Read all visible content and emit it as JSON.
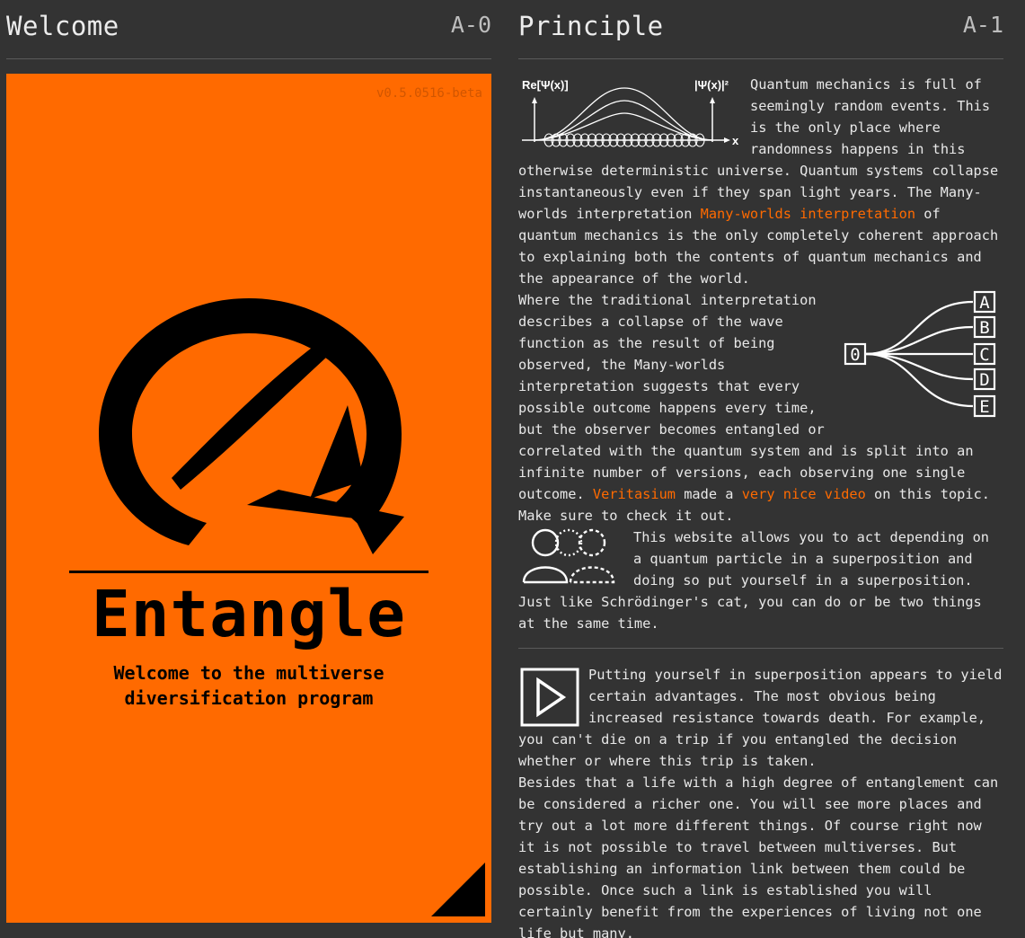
{
  "left_panel": {
    "title": "Welcome",
    "code": "A-0",
    "card": {
      "version": "v0.5.0516-beta",
      "brand": "Entangle",
      "tagline_line1": "Welcome to the multiverse",
      "tagline_line2": "diversification program",
      "accent_color": "#ff6a00"
    }
  },
  "right_panel": {
    "title": "Principle",
    "code": "A-1",
    "wave_figure": {
      "label_left": "Re[Ψ(x)]",
      "label_right": "|Ψ(x)|²",
      "axis_label": "x"
    },
    "branch_figure": {
      "source": "0",
      "outcomes": [
        "A",
        "B",
        "C",
        "D",
        "E"
      ]
    },
    "section1": {
      "p1": "Quantum mechanics is full of seemingly random events. This is the only place where randomness happens in this otherwise deterministic universe. Quantum systems collapse instantaneously even if they span light years. The Many-worlds interpretation ",
      "link_many_worlds": "Many-worlds interpretation",
      "p1_end": " of quantum mechanics is the only completely coherent approach to explaining both the contents of quantum mechanics and the appearance of the world.",
      "p2": "Where the traditional interpretation describes a collapse of the wave function as the result of being observed, the Many-worlds interpretation suggests that every possible outcome happens every time, but the observer becomes entangled or correlated with the quantum system and is split into an infinite number of versions, each observing one single outcome. ",
      "link_veritasium": "Veritasium",
      "p2_mid": " made a ",
      "link_video": "very nice video",
      "p2_end": " on this topic. Make sure to check it out.",
      "p3": "This website allows you to act depending on a quantum particle in a superposition and doing so put yourself in a superposition. Just like Schrödinger's cat, you can do or be two things at the same time."
    },
    "section2": {
      "p1": "Putting yourself in superposition appears to yield certain advantages. The most obvious being increased resistance towards death. For example, you can't die on a trip if you entangled the decision whether or where this trip is taken.",
      "p2": "Besides that a life with a high degree of entanglement can be considered a richer one. You will see more places and try out a lot more different things. Of course right now it is not possible to travel between multiverses. But establishing an information link between them could be possible. Once such a link is established you will certainly benefit from the experiences of living not one life but many."
    }
  }
}
